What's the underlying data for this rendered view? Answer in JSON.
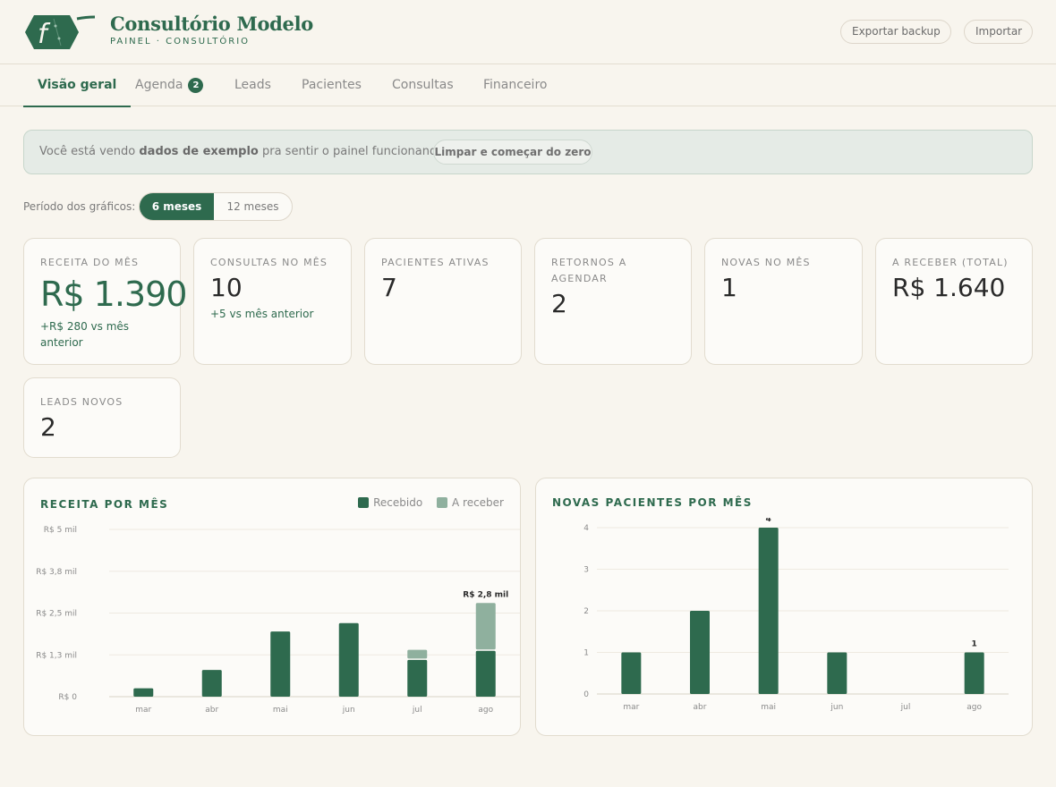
{
  "header": {
    "brand_title": "Consultório Modelo",
    "brand_subtitle": "PAINEL · CONSULTÓRIO",
    "export_label": "Exportar backup",
    "import_label": "Importar",
    "brand_color": "#2e6a4e"
  },
  "tabs": [
    {
      "label": "Visão geral",
      "active": true
    },
    {
      "label": "Agenda",
      "badge": "2"
    },
    {
      "label": "Leads"
    },
    {
      "label": "Pacientes"
    },
    {
      "label": "Consultas"
    },
    {
      "label": "Financeiro"
    }
  ],
  "banner": {
    "text_before": "Você está vendo ",
    "text_bold": "dados de exemplo",
    "text_after": " pra sentir o painel funcionando.",
    "button_label": "Limpar e começar do zero"
  },
  "period": {
    "label": "Período dos gráficos:",
    "options": [
      "6 meses",
      "12 meses"
    ],
    "selected": "6 meses"
  },
  "kpis": [
    {
      "label": "Receita do mês",
      "value": "R$ 1.390",
      "note": "+R$ 280 vs mês anterior"
    },
    {
      "label": "Consultas no mês",
      "value": "10",
      "note": "+5 vs mês anterior"
    },
    {
      "label": "Pacientes ativas",
      "value": "7"
    },
    {
      "label": "Retornos a agendar",
      "value": "2"
    },
    {
      "label": "Novas no mês",
      "value": "1"
    },
    {
      "label": "A receber (total)",
      "value": "R$ 1.640"
    },
    {
      "label": "Leads novos",
      "value": "2"
    }
  ],
  "chart_data": [
    {
      "type": "bar",
      "title": "RECEITA POR MÊS",
      "categories": [
        "mar",
        "abr",
        "mai",
        "jun",
        "jul",
        "ago"
      ],
      "stacked": true,
      "series": [
        {
          "name": "Recebido",
          "color": "#2e6a4e",
          "values": [
            0.25,
            0.8,
            1.95,
            2.2,
            1.1,
            1.37
          ]
        },
        {
          "name": "A receber",
          "color": "#8fb09e",
          "values": [
            0,
            0,
            0,
            0,
            0.3,
            1.43
          ]
        }
      ],
      "y_ticks": [
        0,
        1.25,
        2.5,
        3.75,
        5
      ],
      "y_tick_labels": [
        "R$ 0",
        "R$ 1,3 mil",
        "R$ 2,5 mil",
        "R$ 3,8 mil",
        "R$ 5 mil"
      ],
      "ylim": [
        0,
        5
      ],
      "units": "mil",
      "annotations": [
        {
          "category": "ago",
          "text": "R$ 2,8 mil"
        }
      ],
      "legend_position": "top-right",
      "grid": true
    },
    {
      "type": "bar",
      "title": "NOVAS PACIENTES POR MÊS",
      "categories": [
        "mar",
        "abr",
        "mai",
        "jun",
        "jul",
        "ago"
      ],
      "series": [
        {
          "color": "#2e6a4e",
          "values": [
            1,
            2,
            4,
            1,
            0,
            1
          ]
        }
      ],
      "y_ticks": [
        0,
        1,
        2,
        3,
        4
      ],
      "y_tick_labels": [
        "0",
        "1",
        "2",
        "3",
        "4"
      ],
      "ylim": [
        0,
        4
      ],
      "annotations": [
        {
          "category": "mai",
          "text": "4"
        },
        {
          "category": "ago",
          "text": "1"
        }
      ],
      "grid": true
    }
  ]
}
